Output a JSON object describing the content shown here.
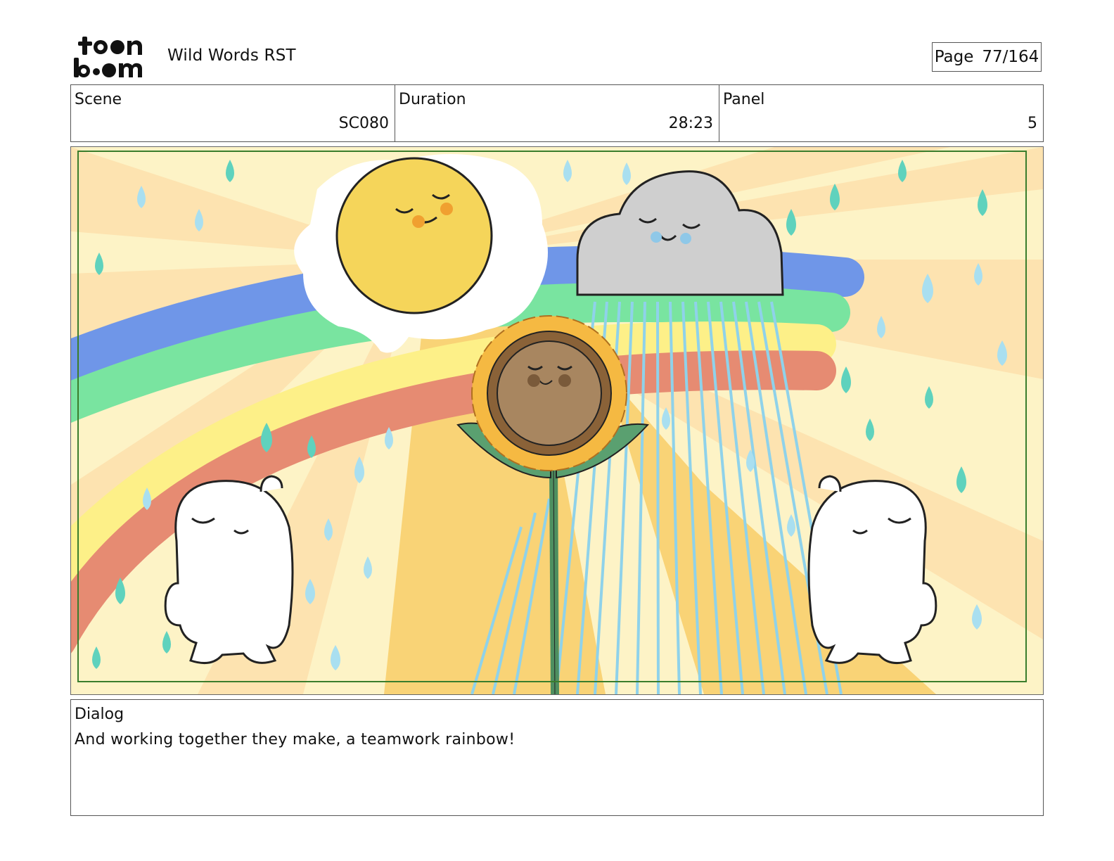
{
  "header": {
    "logo_line1": "toon",
    "logo_line2": "boom",
    "project_title": "Wild Words RST",
    "page_label": "Page",
    "page_value": "77/164"
  },
  "info": {
    "scene_label": "Scene",
    "scene_value": "SC080",
    "duration_label": "Duration",
    "duration_value": "28:23",
    "panel_label": "Panel",
    "panel_value": "5"
  },
  "panel_image": {
    "description_icons": [
      "sun-icon",
      "cloud-icon",
      "sunflower-icon",
      "rainbow-icon",
      "raindrop-icon",
      "character-left",
      "character-right"
    ],
    "colors": {
      "background": "#fdf3c6",
      "ray": "#fde3b0",
      "sun": "#f5d55a",
      "cloud": "#cfcfcf",
      "rainbow_blue": "#6f96e8",
      "rainbow_green": "#79e4a0",
      "rainbow_yellow": "#fdf088",
      "rainbow_red": "#e68b72",
      "raindrop_light": "#a9dff0",
      "raindrop_teal": "#5fd2bd",
      "safe_frame": "#3a7d2c"
    }
  },
  "dialog": {
    "label": "Dialog",
    "text": "And working together they make, a teamwork rainbow!"
  }
}
